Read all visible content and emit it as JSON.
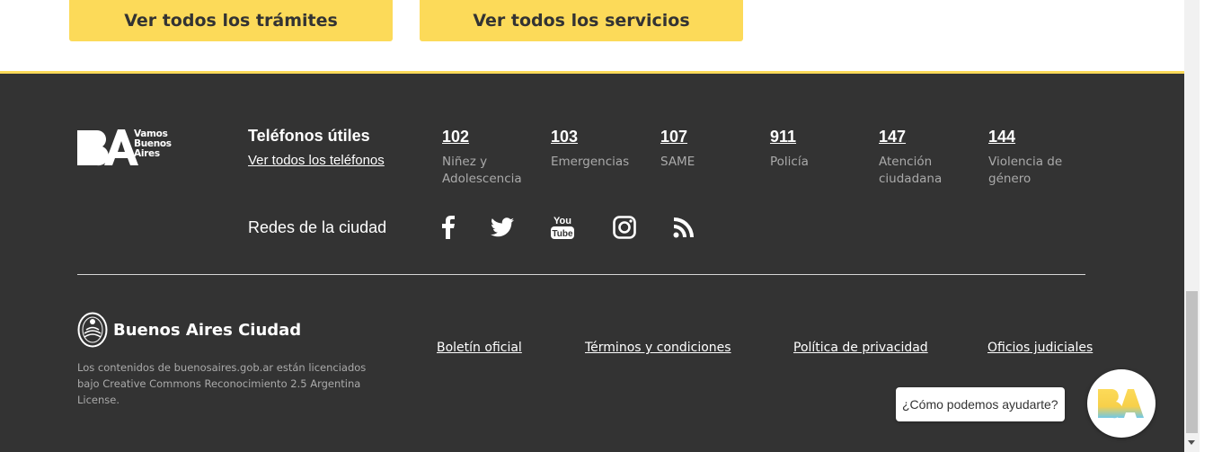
{
  "top_buttons": {
    "tramites": "Ver todos los trámites",
    "servicios": "Ver todos los servicios"
  },
  "brand": {
    "logo_text": "BA",
    "tagline": [
      "Vamos",
      "Buenos",
      "Aires"
    ],
    "accent": "#fcda59",
    "footer_bg": "#333333"
  },
  "phones": {
    "title": "Teléfonos útiles",
    "link": "Ver todos los teléfonos",
    "items": [
      {
        "number": "102",
        "desc": "Niñez y Adolescencia"
      },
      {
        "number": "103",
        "desc": "Emergencias"
      },
      {
        "number": "107",
        "desc": "SAME"
      },
      {
        "number": "911",
        "desc": "Policía"
      },
      {
        "number": "147",
        "desc": "Atención ciudadana"
      },
      {
        "number": "144",
        "desc": "Violencia de género"
      }
    ]
  },
  "social": {
    "title": "Redes de la ciudad",
    "icons": [
      "facebook-icon",
      "twitter-icon",
      "youtube-icon",
      "instagram-icon",
      "rss-icon"
    ]
  },
  "bottom": {
    "org_name": "Buenos Aires Ciudad",
    "license": "Los contenidos de buenosaires.gob.ar están licenciados bajo Creative Commons Reconocimiento 2.5 Argentina License.",
    "links": [
      "Boletín oficial",
      "Términos y condiciones",
      "Política de privacidad",
      "Oficios judiciales"
    ]
  },
  "chat": {
    "prompt": "¿Cómo podemos ayudarte?",
    "avatar_text": "BA"
  }
}
